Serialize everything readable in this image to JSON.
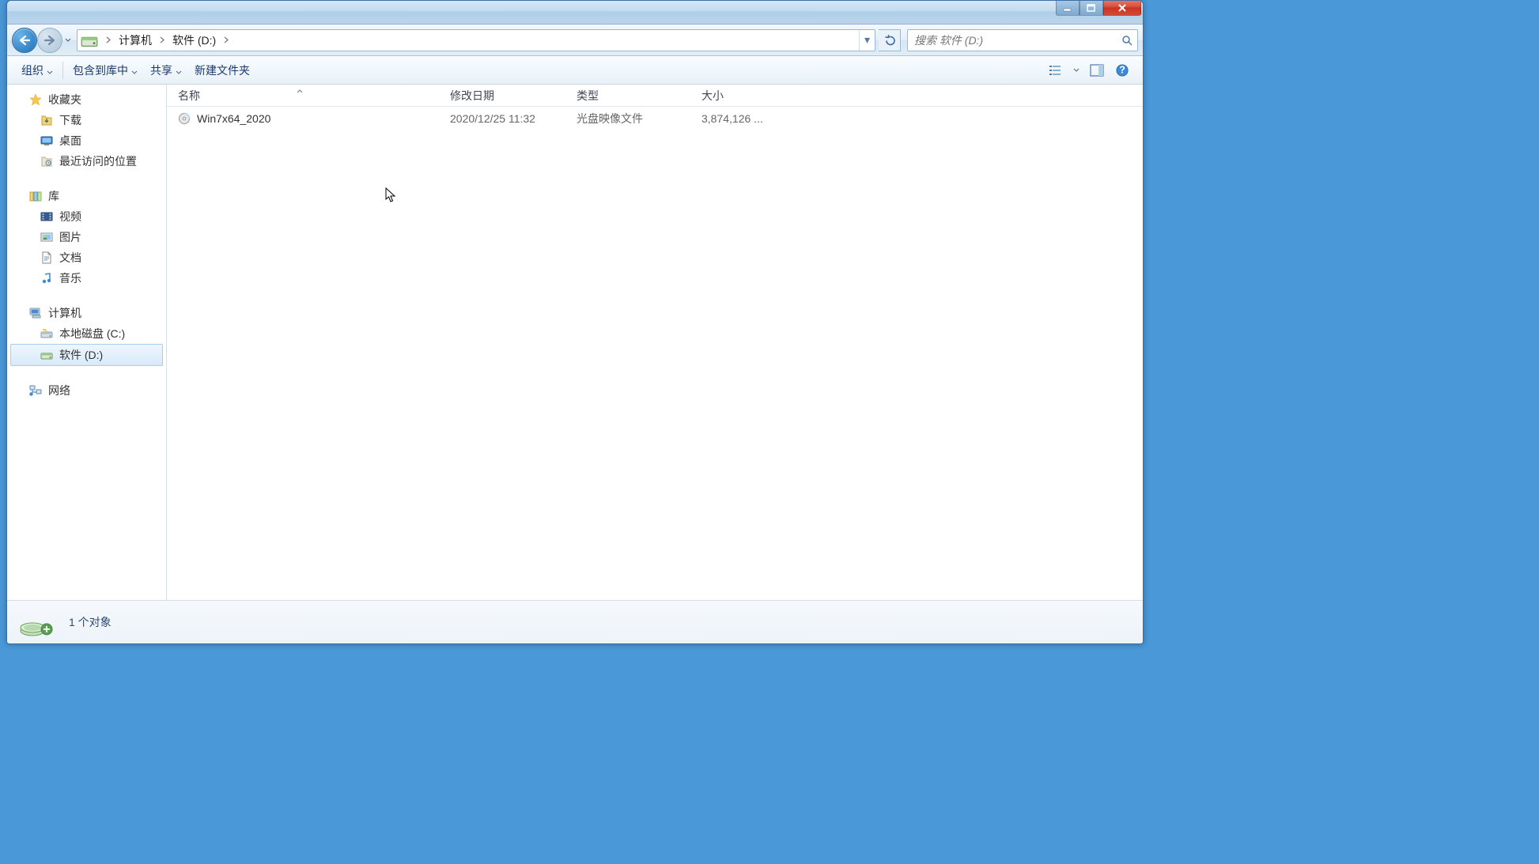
{
  "breadcrumb": {
    "root": "计算机",
    "current": "软件 (D:)"
  },
  "search": {
    "placeholder": "搜索 软件 (D:)"
  },
  "toolbar": {
    "organize": "组织",
    "include": "包含到库中",
    "share": "共享",
    "newfolder": "新建文件夹"
  },
  "sidebar": {
    "favorites": {
      "label": "收藏夹",
      "items": [
        "下载",
        "桌面",
        "最近访问的位置"
      ]
    },
    "library": {
      "label": "库",
      "items": [
        "视频",
        "图片",
        "文档",
        "音乐"
      ]
    },
    "computer": {
      "label": "计算机",
      "items": [
        "本地磁盘 (C:)",
        "软件 (D:)"
      ]
    },
    "network": {
      "label": "网络"
    }
  },
  "columns": {
    "name": "名称",
    "date": "修改日期",
    "type": "类型",
    "size": "大小"
  },
  "files": [
    {
      "name": "Win7x64_2020",
      "date": "2020/12/25 11:32",
      "type": "光盘映像文件",
      "size": "3,874,126 ..."
    }
  ],
  "status": {
    "count": "1 个对象"
  }
}
